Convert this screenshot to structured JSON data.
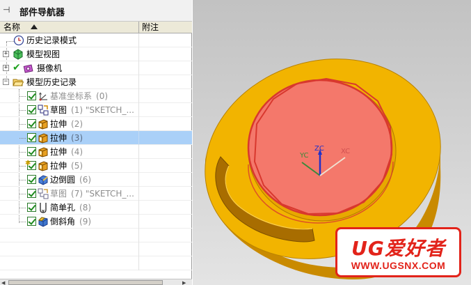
{
  "navigator": {
    "title": "部件导航器",
    "columns": {
      "name": "名称",
      "note": "附注"
    }
  },
  "tree": {
    "history_mode": {
      "label": "历史记录模式"
    },
    "model_views": {
      "label": "模型视图"
    },
    "cameras": {
      "label": "摄像机"
    },
    "model_history": {
      "label": "模型历史记录"
    },
    "features": [
      {
        "label": "基准坐标系",
        "num": "(0)"
      },
      {
        "label": "草图",
        "num": "(1) \"SKETCH_..."
      },
      {
        "label": "拉伸",
        "num": "(2)"
      },
      {
        "label": "拉伸",
        "num": "(3)"
      },
      {
        "label": "拉伸",
        "num": "(4)"
      },
      {
        "label": "拉伸",
        "num": "(5)"
      },
      {
        "label": "边倒圆",
        "num": "(6)"
      },
      {
        "label": "草图",
        "num": "(7) \"SKETCH_..."
      },
      {
        "label": "简单孔",
        "num": "(8)"
      },
      {
        "label": "倒斜角",
        "num": "(9)"
      }
    ]
  },
  "viewport": {
    "axes": {
      "yc": "YC",
      "zc": "ZC",
      "xc": "XC"
    },
    "colors": {
      "part": "#f2b400",
      "part_dark": "#c98a00",
      "face": "#f4786b",
      "edge": "#d8382e"
    }
  },
  "watermark": {
    "text": "UG爱好者",
    "url": "WWW.UGSNX.COM"
  }
}
